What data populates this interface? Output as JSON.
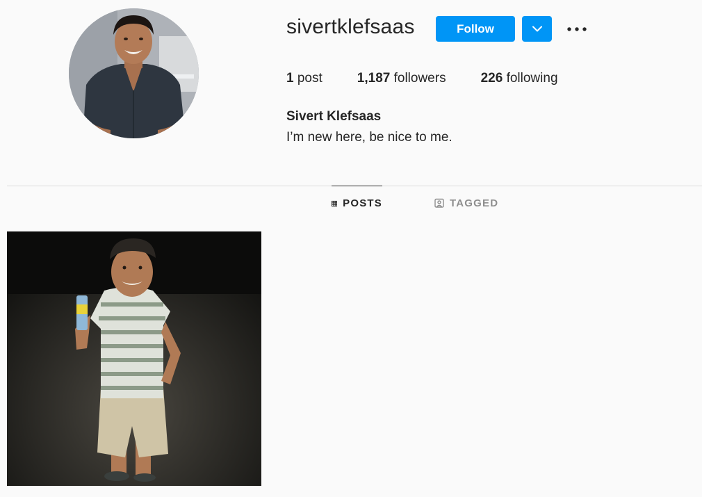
{
  "profile": {
    "username": "sivertklefsaas",
    "full_name": "Sivert Klefsaas",
    "bio": "I’m new here, be nice to me."
  },
  "actions": {
    "follow_label": "Follow",
    "dropdown_icon": "chevron-down-icon",
    "more_icon": "more-options-icon"
  },
  "stats": {
    "posts_count": "1",
    "posts_label": "post",
    "followers_count": "1,187",
    "followers_label": "followers",
    "following_count": "226",
    "following_label": "following"
  },
  "tabs": [
    {
      "label": "POSTS",
      "icon": "grid-icon",
      "active": true
    },
    {
      "label": "TAGGED",
      "icon": "tagged-icon",
      "active": false
    }
  ],
  "colors": {
    "primary_button": "#0095f6",
    "background": "#fafafa",
    "text": "#262626",
    "muted": "#8e8e8e"
  }
}
